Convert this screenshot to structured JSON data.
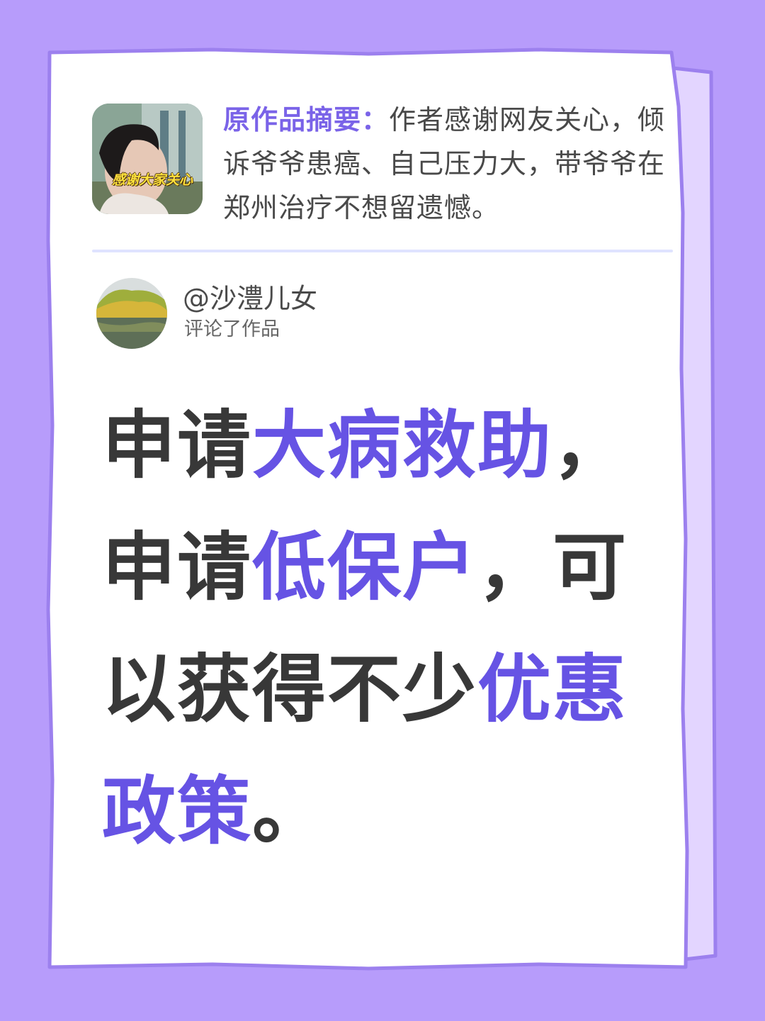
{
  "colors": {
    "background": "#b79cfb",
    "card": "#ffffff",
    "accent": "#6653e4",
    "text": "#383838"
  },
  "summary": {
    "label": "原作品摘要：",
    "text": "作者感谢网友关心，倾诉爷爷患癌、自己压力大，带爷爷在郑州治疗不想留遗憾。",
    "thumbnail_caption": "感谢大家关心"
  },
  "comment": {
    "username": "@沙澧儿女",
    "action": "评论了作品"
  },
  "headline": {
    "line1_a": "申请",
    "line1_b": "大病救助",
    "line1_c": "，",
    "line2_a": "申请",
    "line2_b": "低保户",
    "line2_c": "，可",
    "line3_a": "以获得不少",
    "line3_b": "优惠",
    "line4_a": "政策",
    "line4_b": "。"
  }
}
